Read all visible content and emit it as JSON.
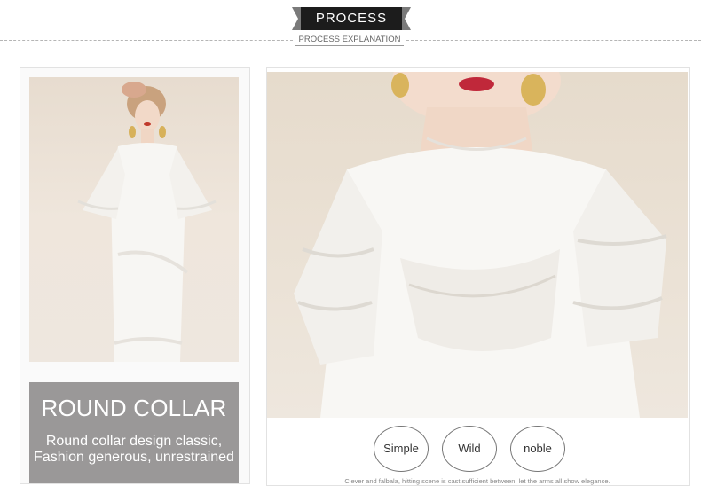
{
  "header": {
    "title": "PROCESS",
    "subtitle": "PROCESS EXPLANATION"
  },
  "feature": {
    "title": "ROUND COLLAR",
    "description_line1": "Round collar design classic,",
    "description_line2": "Fashion generous, unrestrained"
  },
  "tags": [
    "Simple",
    "Wild",
    "noble"
  ],
  "footnote": "Clever and falbala, hitting scene is cast sufficient between, let the arms all show elegance."
}
